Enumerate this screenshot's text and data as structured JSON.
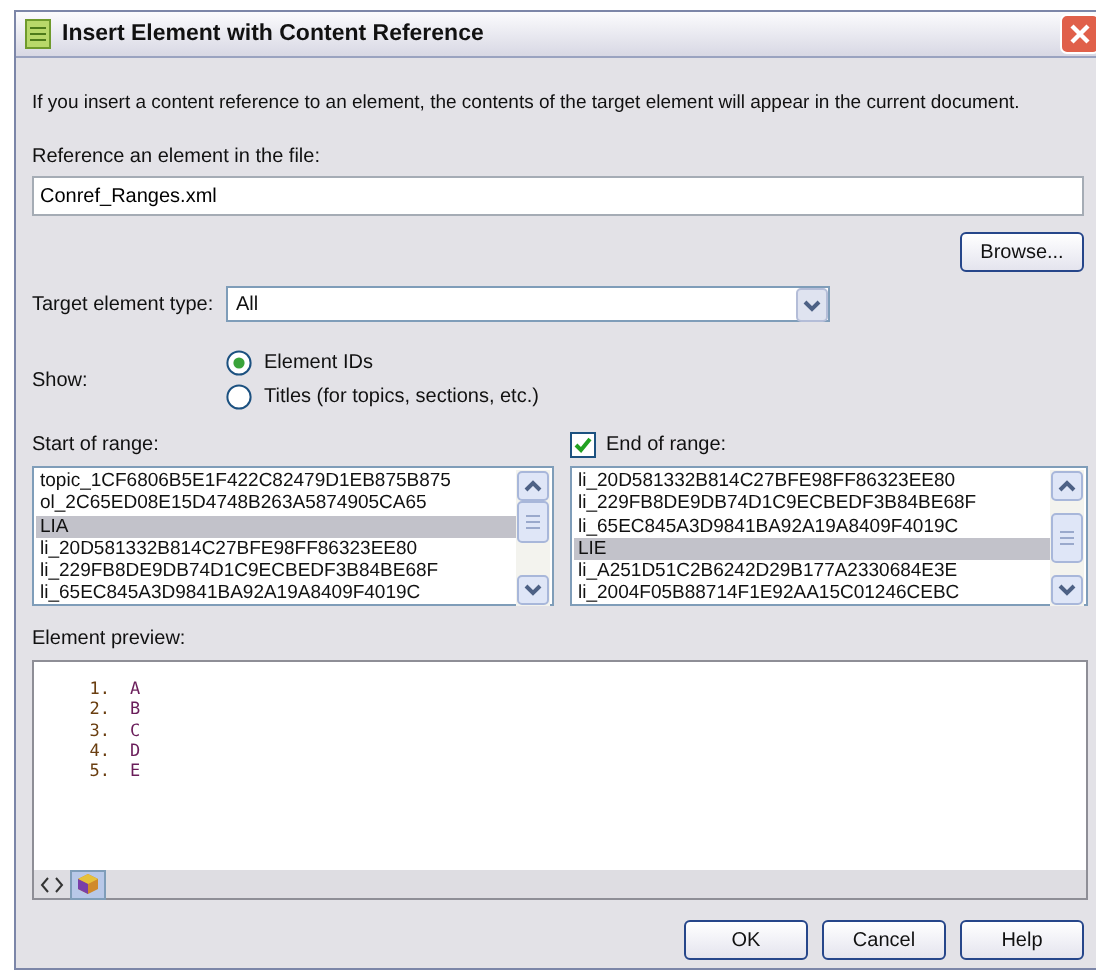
{
  "window": {
    "title": "Insert Element with Content Reference"
  },
  "description": "If you insert a content reference to an element, the contents of the target element will appear in the current document.",
  "file": {
    "label": "Reference an element in the file:",
    "value": "Conref_Ranges.xml",
    "browse_button": "Browse..."
  },
  "target_type": {
    "label": "Target element type:",
    "value": "All"
  },
  "show": {
    "label": "Show:",
    "options": [
      {
        "label": "Element IDs",
        "selected": true
      },
      {
        "label": "Titles (for topics, sections, etc.)",
        "selected": false
      }
    ]
  },
  "start_range": {
    "label": "Start of range:",
    "items": [
      {
        "text": "topic_1CF6806B5E1F422C82479D1EB875B875",
        "selected": false
      },
      {
        "text": "ol_2C65ED08E15D4748B263A5874905CA65",
        "selected": false
      },
      {
        "text": "LIA",
        "selected": true
      },
      {
        "text": "li_20D581332B814C27BFE98FF86323EE80",
        "selected": false
      },
      {
        "text": "li_229FB8DE9DB74D1C9ECBEDF3B84BE68F",
        "selected": false
      },
      {
        "text": "li_65EC845A3D9841BA92A19A8409F4019C",
        "selected": false
      }
    ]
  },
  "end_range": {
    "label": "End of range:",
    "checked": true,
    "items": [
      {
        "text": "li_20D581332B814C27BFE98FF86323EE80",
        "selected": false
      },
      {
        "text": "li_229FB8DE9DB74D1C9ECBEDF3B84BE68F",
        "selected": false
      },
      {
        "text": "li_65EC845A3D9841BA92A19A8409F4019C",
        "selected": false
      },
      {
        "text": "LIE",
        "selected": true
      },
      {
        "text": "li_A251D51C2B6242D29B177A2330684E3E",
        "selected": false
      },
      {
        "text": "li_2004F05B88714F1E92AA15C01246CEBC",
        "selected": false
      }
    ]
  },
  "preview": {
    "label": "Element preview:",
    "items": [
      {
        "number": "1.",
        "text": "A"
      },
      {
        "number": "2.",
        "text": "B"
      },
      {
        "number": "3.",
        "text": "C"
      },
      {
        "number": "4.",
        "text": "D"
      },
      {
        "number": "5.",
        "text": "E"
      }
    ],
    "view_tabs": [
      {
        "kind": "tags",
        "selected": false
      },
      {
        "kind": "rendered",
        "selected": true
      }
    ]
  },
  "buttons": [
    "OK",
    "Cancel",
    "Help"
  ]
}
